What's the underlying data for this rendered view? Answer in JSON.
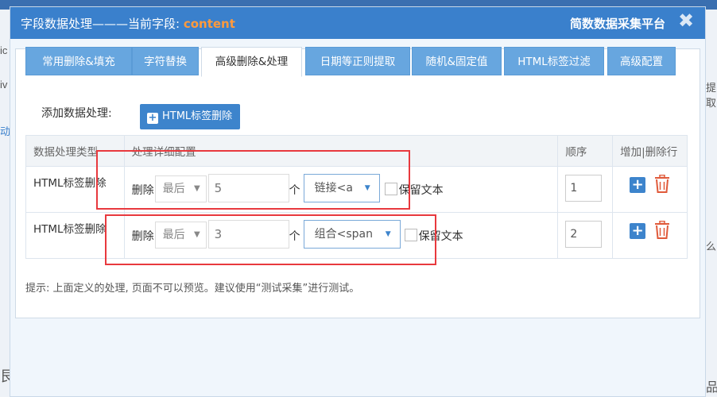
{
  "background": {
    "frag_1": "ic",
    "frag_2": "iv",
    "frag_3": "动",
    "frag_4": "提取",
    "frag_5": "么",
    "frag_6": "艮",
    "frag_7": "品"
  },
  "dialog": {
    "title_prefix": "字段数据处理———当前字段: ",
    "current_field": "content",
    "brand": "简数数据采集平台",
    "close_icon": "✖"
  },
  "tabs": [
    {
      "label": "常用删除&填充",
      "active": false
    },
    {
      "label": "字符替换",
      "active": false
    },
    {
      "label": "高级删除&处理",
      "active": true
    },
    {
      "label": "日期等正则提取",
      "active": false
    },
    {
      "label": "随机&固定值",
      "active": false
    },
    {
      "label": "HTML标签过滤",
      "active": false
    },
    {
      "label": "高级配置",
      "active": false
    }
  ],
  "add_processing": {
    "label": "添加数据处理:",
    "button_label": "HTML标签删除"
  },
  "table": {
    "headers": [
      "数据处理类型",
      "处理详细配置",
      "顺序",
      "增加|删除行"
    ],
    "rows": [
      {
        "type": "HTML标签删除",
        "delete_label": "删除",
        "position": "最后",
        "count": "5",
        "unit": "个",
        "tag_mode": "链接<a",
        "keep_text_label": "保留文本",
        "keep_text_checked": false,
        "order": "1"
      },
      {
        "type": "HTML标签删除",
        "delete_label": "删除",
        "position": "最后",
        "count": "3",
        "unit": "个",
        "tag_mode": "组合<span",
        "keep_text_label": "保留文本",
        "keep_text_checked": false,
        "order": "2"
      }
    ]
  },
  "hint": "提示: 上面定义的处理, 页面不可以预览。建议使用“测试采集”进行测试。",
  "colors": {
    "titlebar": "#3a80cc",
    "current_field": "#ff9a3c",
    "tab_inactive": "#67a6df",
    "primary_button": "#3d84cc",
    "delete_icon": "#e05a3a",
    "highlight_box": "#e8393e"
  }
}
